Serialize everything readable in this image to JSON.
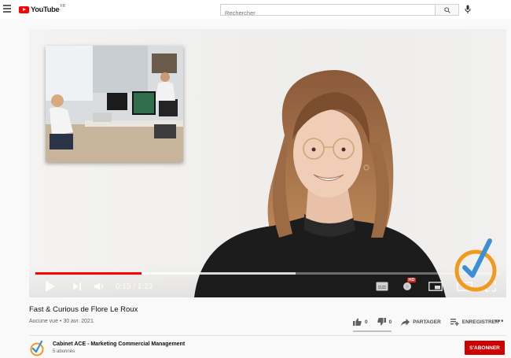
{
  "header": {
    "logo_text": "YouTube",
    "logo_region": "FR",
    "search_placeholder": "Rechercher",
    "icons": [
      "menu-icon",
      "search-icon",
      "microphone-icon"
    ]
  },
  "player": {
    "current_time": "0:15",
    "duration": "1:23",
    "time_display": "0:15 / 1:23",
    "played_fraction": 0.2286,
    "buffered_fraction": 0.5601,
    "hd_badge": "HD",
    "icons": [
      "play-icon",
      "next-icon",
      "volume-icon",
      "subtitles-icon",
      "settings-icon",
      "miniplayer-icon",
      "theater-icon",
      "fullscreen-icon"
    ]
  },
  "video": {
    "title": "Fast & Curious de Flore Le Roux",
    "meta": "Aucune vue • 30 avr. 2021",
    "likes": "0",
    "dislikes": "0",
    "share_label": "PARTAGER",
    "save_label": "ENREGISTRER",
    "more_label": "•••"
  },
  "channel": {
    "name": "Cabinet ACE - Marketing Commercial Management",
    "subscribers": "5 abonnés",
    "subscribe_label": "S'ABONNER"
  },
  "colors": {
    "brand_red": "#ff0000",
    "subscribe_red": "#cc0000",
    "ace_orange": "#f29a1f",
    "ace_blue": "#3a8fd6"
  }
}
